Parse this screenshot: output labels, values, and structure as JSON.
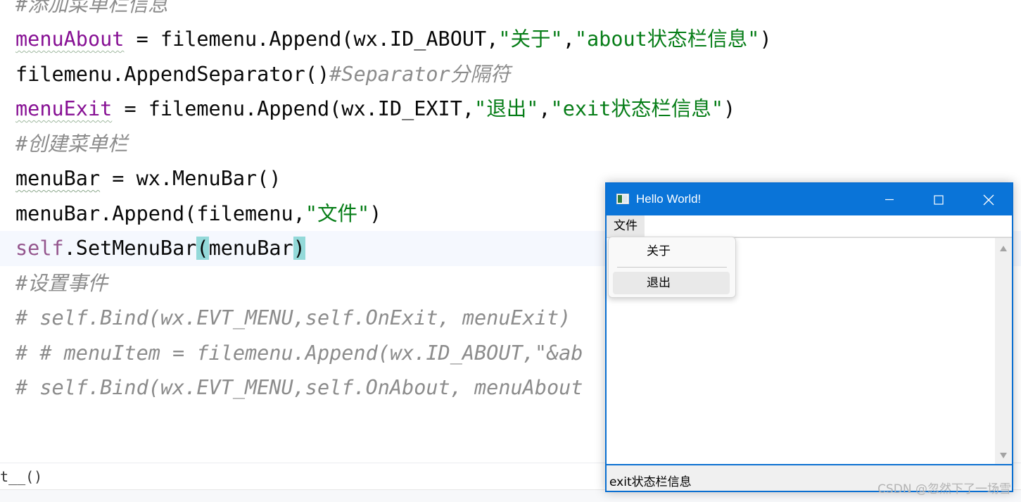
{
  "editor": {
    "lines": [
      [
        {
          "t": "#添加菜单栏信息",
          "c": "comment"
        }
      ],
      [
        {
          "t": "menuAbout",
          "c": "var-ul"
        },
        {
          "t": " = filemenu.Append(wx.ID_ABOUT,",
          "c": "plain"
        },
        {
          "t": "\"关于\"",
          "c": "str"
        },
        {
          "t": ",",
          "c": "plain"
        },
        {
          "t": "\"about状态栏信息\"",
          "c": "str"
        },
        {
          "t": ")",
          "c": "plain"
        }
      ],
      [
        {
          "t": "filemenu.AppendSeparator()",
          "c": "plain"
        },
        {
          "t": "#Separator分隔符",
          "c": "comment"
        }
      ],
      [
        {
          "t": "menuExit",
          "c": "var-ul"
        },
        {
          "t": " = filemenu.Append(wx.ID_EXIT,",
          "c": "plain"
        },
        {
          "t": "\"退出\"",
          "c": "str"
        },
        {
          "t": ",",
          "c": "plain"
        },
        {
          "t": "\"exit状态栏信息\"",
          "c": "str"
        },
        {
          "t": ")",
          "c": "plain"
        }
      ],
      [
        {
          "t": "#创建菜单栏",
          "c": "comment"
        }
      ],
      [
        {
          "t": "menuBar",
          "c": "plain-ul"
        },
        {
          "t": " = wx.MenuBar()",
          "c": "plain"
        }
      ],
      [
        {
          "t": "menuBar.Append(filemenu,",
          "c": "plain"
        },
        {
          "t": "\"文件\"",
          "c": "str"
        },
        {
          "t": ")",
          "c": "plain"
        }
      ],
      [
        {
          "t": "self",
          "c": "self"
        },
        {
          "t": ".SetMenuBar",
          "c": "plain"
        },
        {
          "t": "(",
          "c": "paren"
        },
        {
          "t": "menuBar",
          "c": "plain"
        },
        {
          "t": ")",
          "c": "paren"
        }
      ],
      [
        {
          "t": "#设置事件",
          "c": "comment"
        }
      ],
      [
        {
          "t": "# self.Bind(wx.EVT_MENU,self.OnExit, menuExit)",
          "c": "comment"
        }
      ],
      [
        {
          "t": "# # menuItem = filemenu.Append(wx.ID_ABOUT,\"&ab",
          "c": "comment"
        }
      ],
      [
        {
          "t": "# self.Bind(wx.EVT_MENU,self.OnAbout, menuAbout",
          "c": "comment"
        }
      ]
    ],
    "current_line_index": 7
  },
  "breadcrumb": {
    "text": "t__()"
  },
  "wx_window": {
    "title": "Hello World!",
    "menu_file_label": "文件",
    "status_text": "exit状态栏信息",
    "controls": [
      "minimize-icon",
      "maximize-icon",
      "close-icon"
    ]
  },
  "dropdown": {
    "items": [
      {
        "label": "关于",
        "hover": false
      },
      {
        "label": "退出",
        "hover": true
      }
    ]
  },
  "watermark": {
    "text": "CSDN @忽然下了一场雪"
  },
  "colors": {
    "titlebar": "#0a74d8",
    "string": "#067d17",
    "comment": "#8c8c8c",
    "variable": "#871094",
    "self": "#94558d",
    "paren_highlight": "#93d9d9"
  }
}
